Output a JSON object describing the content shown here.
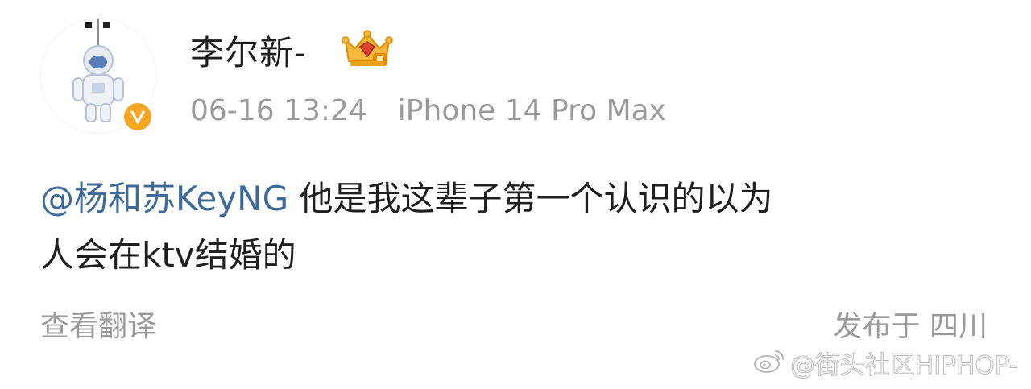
{
  "post": {
    "author": {
      "name": "李尔新-",
      "avatar_icon": "astronaut-avatar-icon",
      "verified_icon": "verified-v-icon",
      "vip_icon": "vip-crown-badge-icon"
    },
    "timestamp": "06-16 13:24",
    "device": "iPhone 14 Pro Max",
    "mention": "@杨和苏KeyNG",
    "text_line1": " 他是我这辈子第一个认识的以为",
    "text_line2": "人会在ktv结婚的",
    "translate_label": "查看翻译",
    "location": "发布于 四川"
  },
  "watermark": {
    "icon": "weibo-icon",
    "text": "@街头社区HIPHOP-"
  },
  "colors": {
    "text": "#1f1f1f",
    "muted": "#9a9a9a",
    "mention": "#3e6a98",
    "verified": "#f5a623"
  }
}
